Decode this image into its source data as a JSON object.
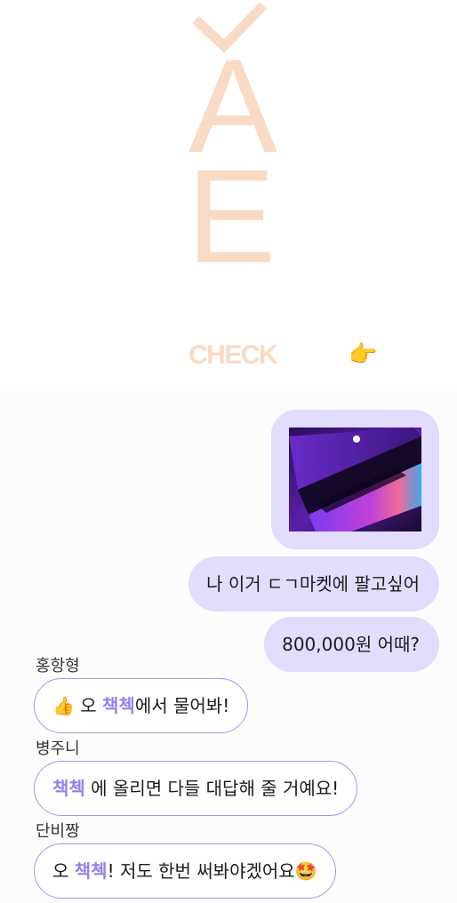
{
  "hero": {
    "letter_a": "A",
    "letter_e": "E",
    "check_word": "CHECK",
    "pointing_emoji": "👉"
  },
  "chat": {
    "photo_alt": "laptop photo",
    "outgoing": [
      "나 이거 ㄷㄱ마켓에 팔고싶어",
      "800,000원 어때?"
    ],
    "replies": [
      {
        "name": "홍항형",
        "emoji_before": "👍",
        "before": " 오 ",
        "highlight": "책첵",
        "after": "에서 물어봐!",
        "emoji_after": ""
      },
      {
        "name": "병주니",
        "emoji_before": "",
        "before": "",
        "highlight": "책첵",
        "after": " 에 올리면 다들 대답해 줄 거예요!",
        "emoji_after": ""
      },
      {
        "name": "단비짱",
        "emoji_before": "",
        "before": "오 ",
        "highlight": "책첵",
        "after": "!  저도 한번 써봐야겠어요",
        "emoji_after": "🤩"
      }
    ]
  },
  "colors": {
    "deco": "#f9dac4",
    "bubble_out": "#e2dcfd",
    "bubble_in_border": "#a495ea",
    "highlight": "#9680ec"
  }
}
